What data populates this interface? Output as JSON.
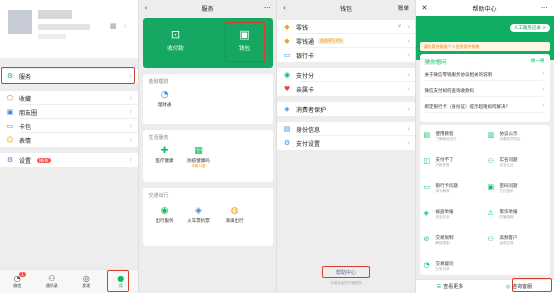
{
  "panel1": {
    "menu": [
      {
        "icon": "services-icon",
        "glyph": "⚙",
        "label": "服务"
      },
      {
        "icon": "favorites-icon",
        "glyph": "⬡",
        "label": "收藏"
      },
      {
        "icon": "moments-icon",
        "glyph": "▣",
        "label": "朋友圈"
      },
      {
        "icon": "cards-icon",
        "glyph": "▭",
        "label": "卡包"
      },
      {
        "icon": "stickers-icon",
        "glyph": "☺",
        "label": "表情"
      },
      {
        "icon": "settings-icon",
        "glyph": "⚙",
        "label": "设置",
        "badge": "NEW"
      }
    ],
    "tabs": [
      {
        "icon": "chats-icon",
        "glyph": "◔",
        "label": "微信",
        "badge": "1"
      },
      {
        "icon": "contacts-icon",
        "glyph": "⚇",
        "label": "通讯录"
      },
      {
        "icon": "discover-icon",
        "glyph": "◎",
        "label": "发现"
      },
      {
        "icon": "me-icon",
        "glyph": "●",
        "label": "我"
      }
    ]
  },
  "panel2": {
    "title": "服务",
    "card": [
      {
        "icon": "scan-pay-icon",
        "glyph": "⊡",
        "label": "收付款"
      },
      {
        "icon": "wallet-icon",
        "glyph": "▣",
        "label": "钱包"
      }
    ],
    "sections": [
      {
        "title": "金融理财",
        "items": [
          {
            "glyph": "◔",
            "label": "理财通"
          }
        ]
      },
      {
        "title": "生活服务",
        "items": [
          {
            "glyph": "✚",
            "label": "医疗健康"
          },
          {
            "glyph": "▦",
            "label": "防疫健康码",
            "sub": "请戴口罩"
          }
        ]
      },
      {
        "title": "交通出行",
        "items": [
          {
            "glyph": "◉",
            "label": "出行服务"
          },
          {
            "glyph": "◈",
            "label": "火车票机票"
          },
          {
            "glyph": "◍",
            "label": "滴滴出行"
          }
        ]
      }
    ]
  },
  "panel3": {
    "title": "钱包",
    "right_label": "账单",
    "rows": [
      {
        "glyph": "◆",
        "label": "零钱",
        "value": "¥"
      },
      {
        "glyph": "◆",
        "label": "零钱通",
        "tag": "收益率1.4%"
      },
      {
        "glyph": "▭",
        "label": "银行卡"
      },
      {
        "glyph": "◉",
        "label": "支付分"
      },
      {
        "glyph": "♥",
        "label": "亲属卡"
      },
      {
        "glyph": "◈",
        "label": "消费者保护"
      },
      {
        "glyph": "▤",
        "label": "身份信息"
      },
      {
        "glyph": "⚙",
        "label": "支付设置"
      }
    ],
    "help_label": "帮助中心",
    "footer": "本服务由财付通提供"
  },
  "panel4": {
    "title": "帮助中心",
    "service_record": "人工服务记录 >",
    "notice": "谨防冒充客服个人信息保护指南",
    "faq_title": "猜你想问",
    "faq_more": "换一换",
    "faq": [
      "关于微信零钱服务协议相关的说明",
      "微信支付如何查询收款码",
      "绑定银行卡（身份证）提示超限如何解决？"
    ],
    "cats": [
      {
        "label": "使用教程",
        "sub": "了解微信支付"
      },
      {
        "label": "协议公示",
        "sub": "查看各项协议"
      },
      {
        "label": "支付不了",
        "sub": "付款受限"
      },
      {
        "label": "实名问题",
        "sub": "实名认证"
      },
      {
        "label": "银行卡问题",
        "sub": "绑卡解绑"
      },
      {
        "label": "密码问题",
        "sub": "忘记密码"
      },
      {
        "label": "被盗举报",
        "sub": "资金安全"
      },
      {
        "label": "欺诈举报",
        "sub": "防骗指南"
      },
      {
        "label": "交易限制",
        "sub": "解除限制"
      },
      {
        "label": "高频客户",
        "sub": "高频交易"
      },
      {
        "label": "交易疑问",
        "sub": "交易记录"
      }
    ],
    "bottom": [
      {
        "icon": "see-more-icon",
        "label": "查看更多"
      },
      {
        "icon": "contact-support-icon",
        "label": "咨询客服"
      }
    ]
  }
}
